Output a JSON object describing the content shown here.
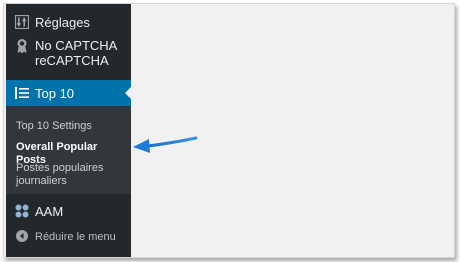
{
  "sidebar": {
    "items": [
      {
        "label": "Réglages",
        "icon": "settings-icon"
      },
      {
        "label": "No CAPTCHA reCAPTCHA",
        "icon": "award-icon"
      },
      {
        "label": "Top 10",
        "icon": "list-icon",
        "active": true
      },
      {
        "label": "AAM",
        "icon": "aam-icon"
      },
      {
        "label": "Réduire le menu",
        "icon": "collapse-icon"
      }
    ],
    "submenu": [
      {
        "label": "Top 10 Settings"
      },
      {
        "label": "Overall Popular Posts",
        "current": true
      },
      {
        "label": "Postes populaires journaliers"
      }
    ]
  },
  "colors": {
    "sidebar_bg": "#23282d",
    "submenu_bg": "#32373c",
    "active_bg": "#0073aa",
    "content_bg": "#f1f1f1",
    "annotation_arrow": "#1e7bd6"
  }
}
